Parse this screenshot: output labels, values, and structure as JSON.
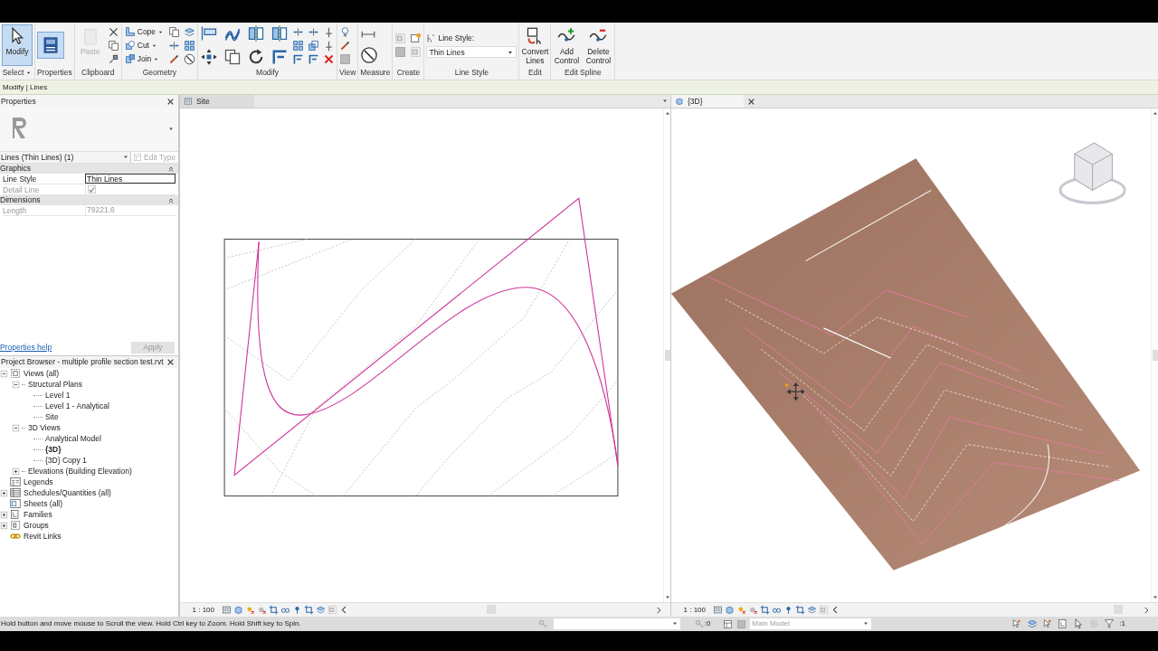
{
  "ribbon": {
    "panels": [
      {
        "kind": "select",
        "label": "Select",
        "tools": [
          {
            "label": "Modify",
            "selected": true,
            "disabled": false
          }
        ]
      },
      {
        "kind": "properties",
        "label": "Properties"
      },
      {
        "kind": "clipboard",
        "label": "Clipboard",
        "tools": [
          {
            "label": "Paste",
            "selected": false,
            "disabled": true
          }
        ]
      },
      {
        "kind": "geometry",
        "label": "Geometry",
        "tools": [
          {
            "label": "Cope",
            "selected": false,
            "disabled": false
          },
          {
            "label": "Cut",
            "selected": false,
            "disabled": false
          },
          {
            "label": "Join",
            "selected": false,
            "disabled": false
          }
        ]
      },
      {
        "kind": "modify",
        "label": "Modify"
      },
      {
        "kind": "view",
        "label": "View"
      },
      {
        "kind": "measure",
        "label": "Measure"
      },
      {
        "kind": "create",
        "label": "Create"
      },
      {
        "kind": "line_style",
        "label": "Line Style",
        "field_label": "Line Style:",
        "value": "Thin Lines"
      },
      {
        "kind": "edit",
        "label": "Edit",
        "tools": [
          {
            "label": "Convert Lines",
            "selected": false,
            "disabled": false
          }
        ]
      },
      {
        "kind": "edit_spline",
        "label": "Edit Spline",
        "tools": [
          {
            "label": "Add Control",
            "selected": false,
            "disabled": false
          },
          {
            "label": "Delete Control",
            "selected": false,
            "disabled": false
          }
        ]
      }
    ]
  },
  "context_bar": "Modify | Lines",
  "properties": {
    "title": "Properties",
    "type_selector": "Lines (Thin Lines) (1)",
    "edit_type": {
      "label": "Edit Type",
      "disabled": true
    },
    "groups": [
      {
        "name": "Graphics",
        "rows": [
          {
            "kind": "text",
            "label": "Line Style",
            "value": "Thin Lines",
            "disabled": false
          },
          {
            "kind": "checkbox",
            "label": "Detail Line",
            "checked": true,
            "disabled": true
          }
        ]
      },
      {
        "name": "Dimensions",
        "rows": [
          {
            "kind": "text",
            "label": "Length",
            "value": "79221.6",
            "disabled": true
          }
        ]
      }
    ],
    "help_link": "Properties help",
    "apply": {
      "label": "Apply",
      "disabled": true
    }
  },
  "project_browser": {
    "title": "Project Browser - multiple profile section test.rvt",
    "tree": [
      {
        "label": "Views (all)",
        "kind": "views",
        "expanded": true,
        "selected": false,
        "children": [
          {
            "label": "Structural Plans",
            "kind": "folder",
            "expanded": true,
            "selected": false,
            "children": [
              {
                "label": "Level 1",
                "kind": "view",
                "selected": false
              },
              {
                "label": "Level 1 - Analytical",
                "kind": "view",
                "selected": false
              },
              {
                "label": "Site",
                "kind": "view",
                "selected": false
              }
            ]
          },
          {
            "label": "3D Views",
            "kind": "folder",
            "expanded": true,
            "selected": false,
            "children": [
              {
                "label": "Analytical Model",
                "kind": "view",
                "selected": false
              },
              {
                "label": "{3D}",
                "kind": "view",
                "selected": true
              },
              {
                "label": "{3D} Copy 1",
                "kind": "view",
                "selected": false
              }
            ]
          },
          {
            "label": "Elevations (Building Elevation)",
            "kind": "folder",
            "expanded": false,
            "selected": false
          }
        ]
      },
      {
        "label": "Legends",
        "kind": "legends",
        "selected": false
      },
      {
        "label": "Schedules/Quantities (all)",
        "kind": "schedules",
        "expanded": false,
        "selected": false
      },
      {
        "label": "Sheets (all)",
        "kind": "sheets",
        "selected": false
      },
      {
        "label": "Families",
        "kind": "families",
        "expanded": false,
        "selected": false
      },
      {
        "label": "Groups",
        "kind": "groups",
        "expanded": false,
        "selected": false
      },
      {
        "label": "Revit Links",
        "kind": "links",
        "selected": false
      }
    ]
  },
  "views": [
    {
      "title": "Site",
      "kind": "plan",
      "closable": false,
      "scale": "1 : 100"
    },
    {
      "title": "{3D}",
      "kind": "perspective",
      "closable": true,
      "scale": "1 : 100"
    }
  ],
  "status_bar": {
    "message": "Hold button and move mouse to Scroll the view. Hold Ctrl key to Zoom. Hold Shift key to Spin.",
    "selection_count": ":0",
    "model": "Main Model",
    "filter_count": ":1"
  }
}
